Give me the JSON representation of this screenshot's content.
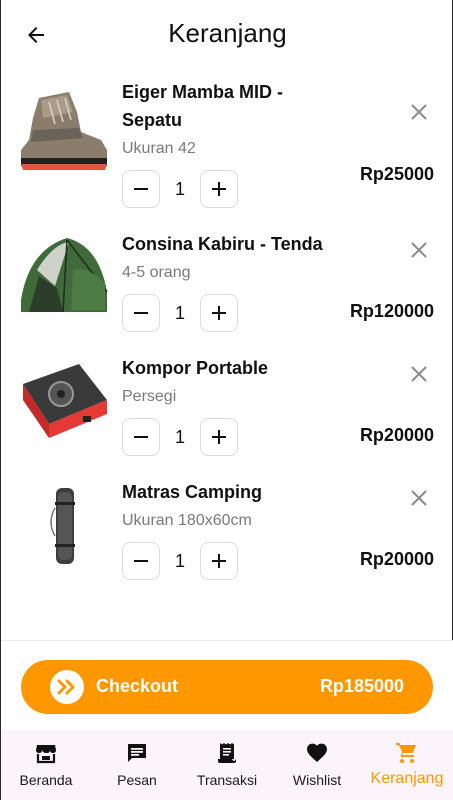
{
  "header": {
    "title": "Keranjang"
  },
  "cart": {
    "items": [
      {
        "name": "Eiger Mamba MID - Sepatu",
        "variant": "Ukuran 42",
        "qty": "1",
        "price": "Rp25000"
      },
      {
        "name": "Consina Kabiru - Tenda",
        "variant": "4-5 orang",
        "qty": "1",
        "price": "Rp120000"
      },
      {
        "name": "Kompor Portable",
        "variant": "Persegi",
        "qty": "1",
        "price": "Rp20000"
      },
      {
        "name": "Matras Camping",
        "variant": "Ukuran 180x60cm",
        "qty": "1",
        "price": "Rp20000"
      }
    ]
  },
  "checkout": {
    "label": "Checkout",
    "total": "Rp185000"
  },
  "nav": {
    "items": [
      {
        "label": "Beranda",
        "icon": "store-icon"
      },
      {
        "label": "Pesan",
        "icon": "chat-icon"
      },
      {
        "label": "Transaksi",
        "icon": "receipt-icon"
      },
      {
        "label": "Wishlist",
        "icon": "heart-icon"
      },
      {
        "label": "Keranjang",
        "icon": "cart-icon",
        "active": true
      }
    ]
  },
  "colors": {
    "accent": "#ff9800",
    "nav_bg": "#fcf4fb"
  }
}
